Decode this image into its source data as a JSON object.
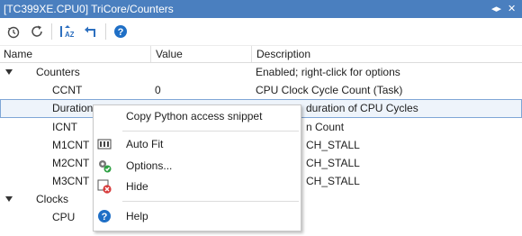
{
  "window": {
    "title": "[TC399XE.CPU0] TriCore/Counters",
    "menu_glyph": "◂▸",
    "close_glyph": "✕"
  },
  "toolbar": {
    "buttons": [
      "history-icon",
      "refresh-icon",
      "sort-icon",
      "back-arrow-icon",
      "help-icon"
    ]
  },
  "columns": {
    "name": "Name",
    "value": "Value",
    "description": "Description"
  },
  "rows": [
    {
      "name": "Counters",
      "value": "",
      "description": "Enabled; right-click for options"
    },
    {
      "name": "CCNT",
      "value": "0",
      "description": "CPU Clock Cycle Count (Task)"
    },
    {
      "name": "Duration",
      "value": "",
      "description": "duration of CPU Cycles"
    },
    {
      "name": "ICNT",
      "value": "",
      "description": "n Count"
    },
    {
      "name": "M1CNT",
      "value": "",
      "description": "CH_STALL"
    },
    {
      "name": "M2CNT",
      "value": "",
      "description": "CH_STALL"
    },
    {
      "name": "M3CNT",
      "value": "",
      "description": "CH_STALL"
    },
    {
      "name": "Clocks",
      "value": "",
      "description": ""
    },
    {
      "name": "CPU",
      "value": "",
      "description": ""
    }
  ],
  "context_menu": {
    "items": [
      {
        "label": "Copy Python access snippet",
        "icon": ""
      },
      {
        "label": "Auto Fit",
        "icon": "autofit-icon"
      },
      {
        "label": "Options...",
        "icon": "options-gear-icon"
      },
      {
        "label": "Hide",
        "icon": "hide-icon"
      },
      {
        "label": "Help",
        "icon": "help-icon"
      }
    ]
  },
  "colors": {
    "titlebar": "#4a7fbf",
    "accent": "#2c6fbf",
    "selection_border": "#7fa6d6"
  }
}
